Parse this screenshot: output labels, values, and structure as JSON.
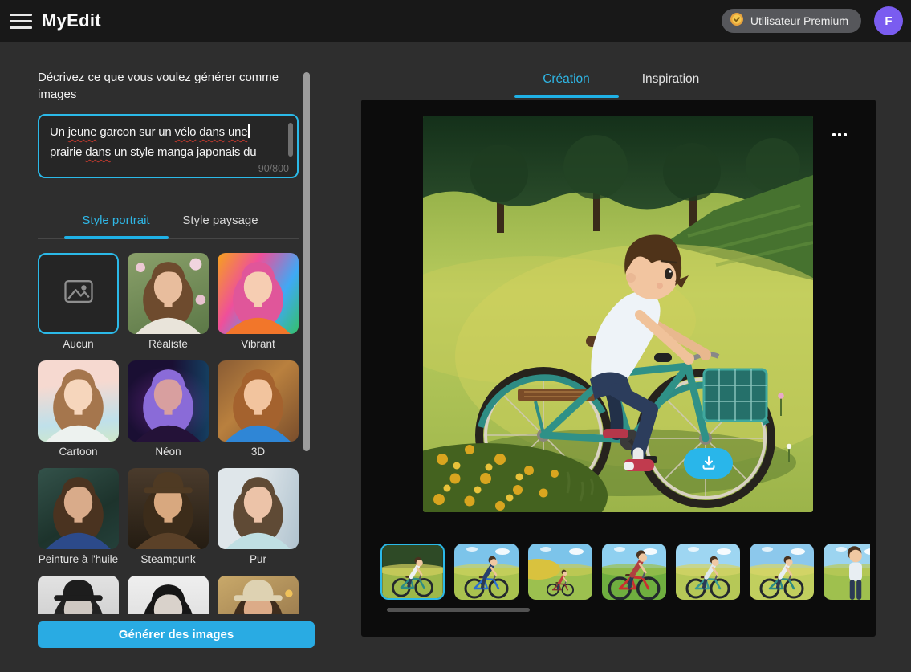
{
  "colors": {
    "accent": "#2bb3e6",
    "generate_button": "#29abe3",
    "avatar": "#7a5cf0",
    "premium_badge_gold": "#f2b737"
  },
  "header": {
    "app_title": "MyEdit",
    "menu_icon": "hamburger-icon",
    "premium_icon": "premium-badge-icon",
    "premium_label": "Utilisateur Premium",
    "avatar_letter": "F"
  },
  "left_panel": {
    "prompt_label": "Décrivez ce que vous voulez générer comme images",
    "prompt_value": "Un jeune garcon sur un vélo dans une prairie dans un style manga japonais du",
    "misspelled_words": [
      "jeune",
      "vélo",
      "dans",
      "une"
    ],
    "caret_after_word": "une",
    "char_counter": "90/800",
    "tabs": [
      {
        "label": "Style portrait",
        "active": true
      },
      {
        "label": "Style paysage",
        "active": false
      }
    ],
    "styles": [
      {
        "label": "Aucun",
        "selected": true
      },
      {
        "label": "Réaliste",
        "selected": false
      },
      {
        "label": "Vibrant",
        "selected": false
      },
      {
        "label": "Cartoon",
        "selected": false
      },
      {
        "label": "Néon",
        "selected": false
      },
      {
        "label": "3D",
        "selected": false
      },
      {
        "label": "Peinture à l'huile",
        "selected": false
      },
      {
        "label": "Steampunk",
        "selected": false
      },
      {
        "label": "Pur",
        "selected": false
      }
    ],
    "partial_style_thumbs": [
      "style-thumb-10",
      "style-thumb-11",
      "style-thumb-12"
    ],
    "generate_label": "Générer des images"
  },
  "right_panel": {
    "tabs": [
      {
        "label": "Création",
        "active": true
      },
      {
        "label": "Inspiration",
        "active": false
      }
    ],
    "more_icon": "ellipsis-icon",
    "download_icon": "download-icon",
    "thumbnails": [
      {
        "name": "variation-1",
        "selected": true
      },
      {
        "name": "variation-2",
        "selected": false
      },
      {
        "name": "variation-3",
        "selected": false
      },
      {
        "name": "variation-4",
        "selected": false
      },
      {
        "name": "variation-5",
        "selected": false
      },
      {
        "name": "variation-6",
        "selected": false
      },
      {
        "name": "variation-7",
        "selected": false
      }
    ]
  }
}
